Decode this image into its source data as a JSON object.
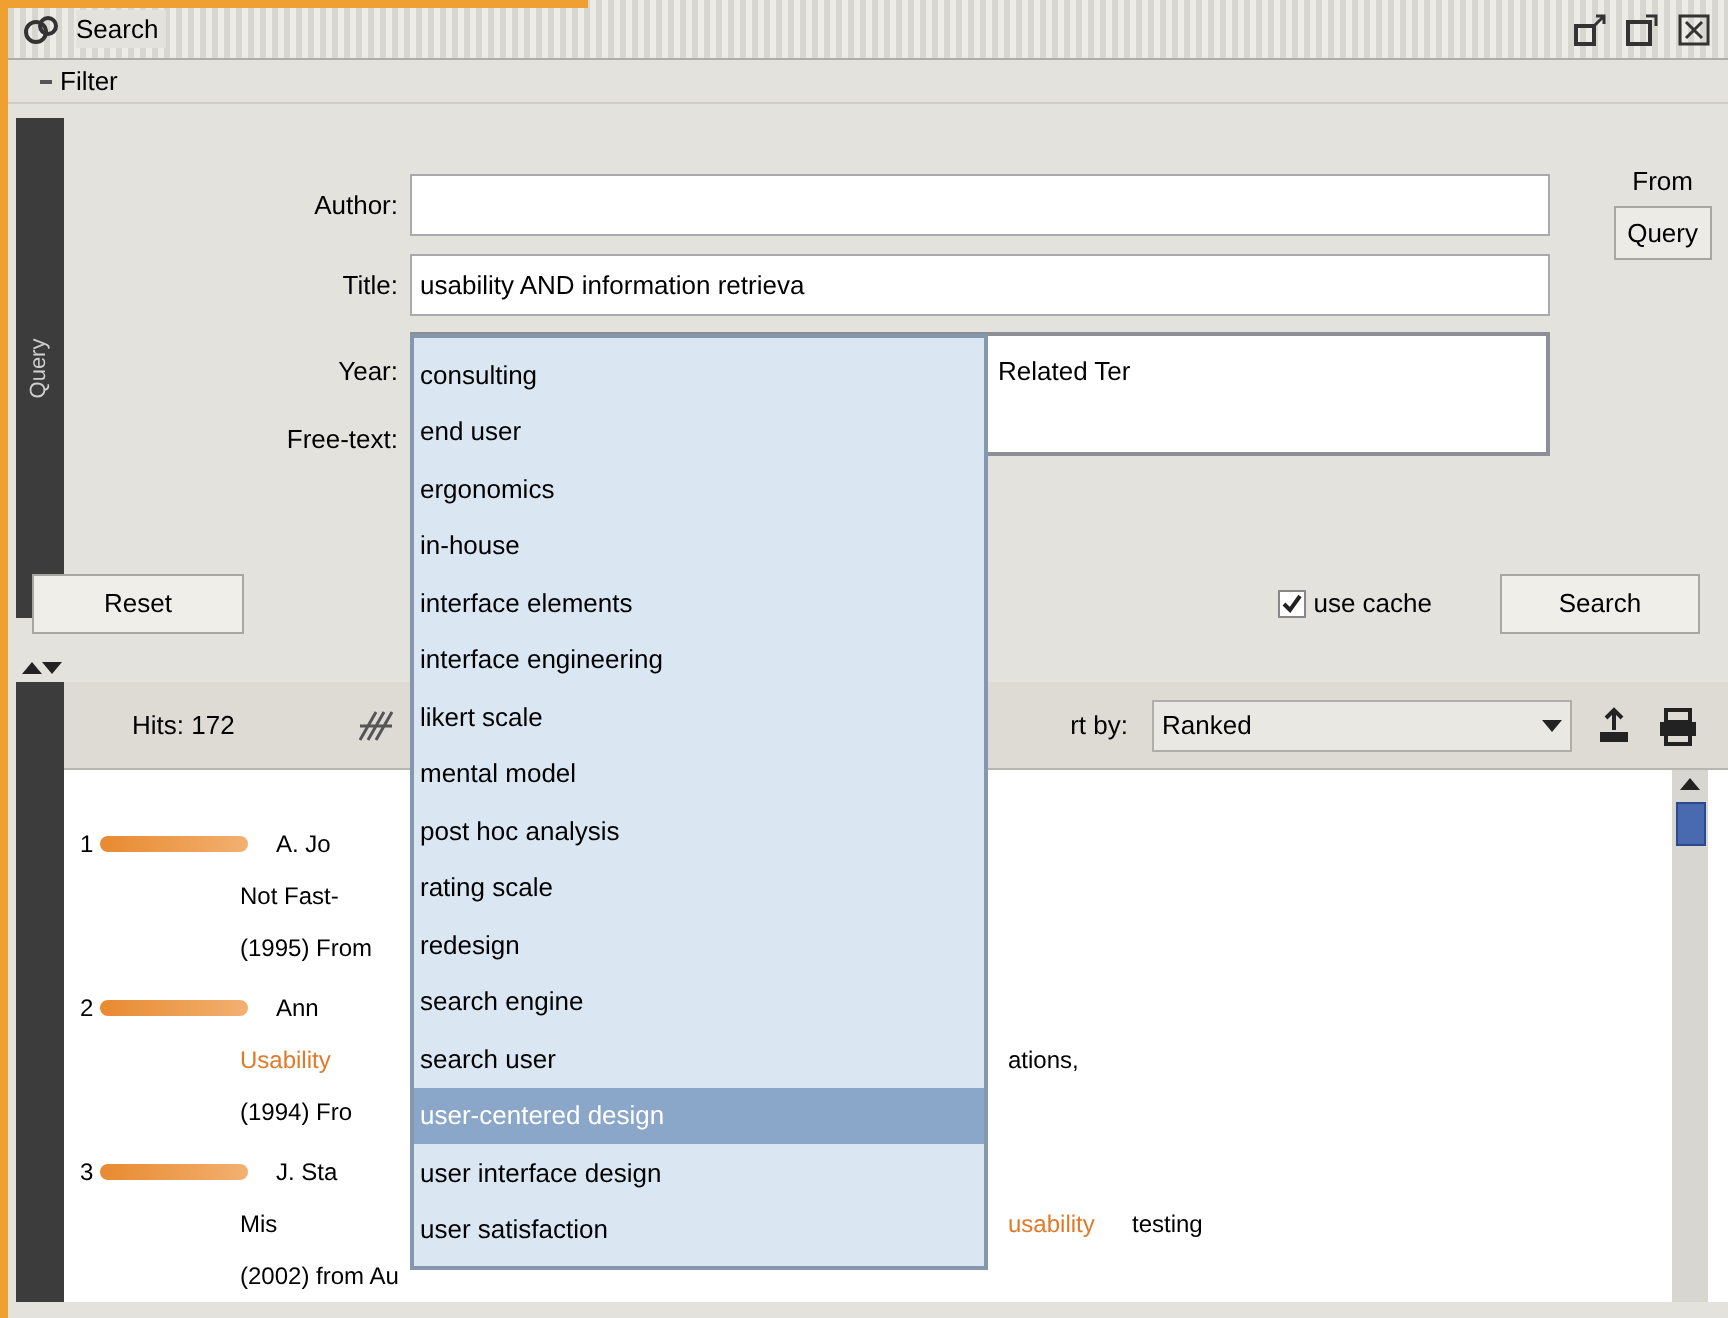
{
  "window": {
    "title": "Search"
  },
  "filter": {
    "label": "Filter"
  },
  "query_panel": {
    "tab": "Query",
    "fields": [
      {
        "label": "Author:",
        "kind": "line"
      },
      {
        "label": "Title:",
        "value": "usability AND information retrieva",
        "kind": "line"
      }
    ],
    "area_labels": [
      "Year:",
      "Free-text:"
    ],
    "free_text": {
      "value": "Related Ter"
    },
    "from_query": {
      "label_top": "From",
      "button": "Query"
    },
    "reset": "Reset",
    "use_cache": {
      "label": "use cache",
      "checked": true
    },
    "search": "Search"
  },
  "results_toolbar": {
    "hits": "Hits: 172",
    "sort_label": "rt by:",
    "sort_value": "Ranked"
  },
  "results": [
    {
      "rank": "1",
      "lines": [
        [
          {
            "text": "A. Jo",
            "highlight": false
          }
        ],
        [
          {
            "text": "Not Fast-",
            "highlight": false
          }
        ],
        [
          {
            "text": "(1995) From",
            "highlight": false
          }
        ]
      ]
    },
    {
      "rank": "2",
      "lines": [
        [
          {
            "text": "Ann",
            "highlight": false
          }
        ],
        [
          {
            "text": "Usability",
            "highlight": true
          },
          {
            "text": "ations,",
            "highlight": false,
            "right": true
          }
        ],
        [
          {
            "text": "(1994) Fro",
            "highlight": false
          }
        ]
      ]
    },
    {
      "rank": "3",
      "lines": [
        [
          {
            "text": "J. Sta",
            "highlight": false
          }
        ],
        [
          {
            "text": "Mis",
            "highlight": false
          },
          {
            "text": "usability",
            "highlight": true,
            "right": true
          },
          {
            "text": "testing",
            "highlight": false
          }
        ],
        [
          {
            "text": "(2002) from Au",
            "highlight": false
          }
        ]
      ]
    }
  ],
  "suggestions": [
    {
      "label": "consulting",
      "selected": false
    },
    {
      "label": "end user",
      "selected": false
    },
    {
      "label": "ergonomics",
      "selected": false
    },
    {
      "label": "in-house",
      "selected": false
    },
    {
      "label": "interface elements",
      "selected": false
    },
    {
      "label": "interface engineering",
      "selected": false
    },
    {
      "label": "likert scale",
      "selected": false
    },
    {
      "label": "mental model",
      "selected": false
    },
    {
      "label": "post hoc analysis",
      "selected": false
    },
    {
      "label": "rating scale",
      "selected": false
    },
    {
      "label": "redesign",
      "selected": false
    },
    {
      "label": "search engine",
      "selected": false
    },
    {
      "label": "search user",
      "selected": false
    },
    {
      "label": "user-centered design",
      "selected": true
    },
    {
      "label": "user interface design",
      "selected": false
    },
    {
      "label": "user satisfaction",
      "selected": false
    }
  ]
}
